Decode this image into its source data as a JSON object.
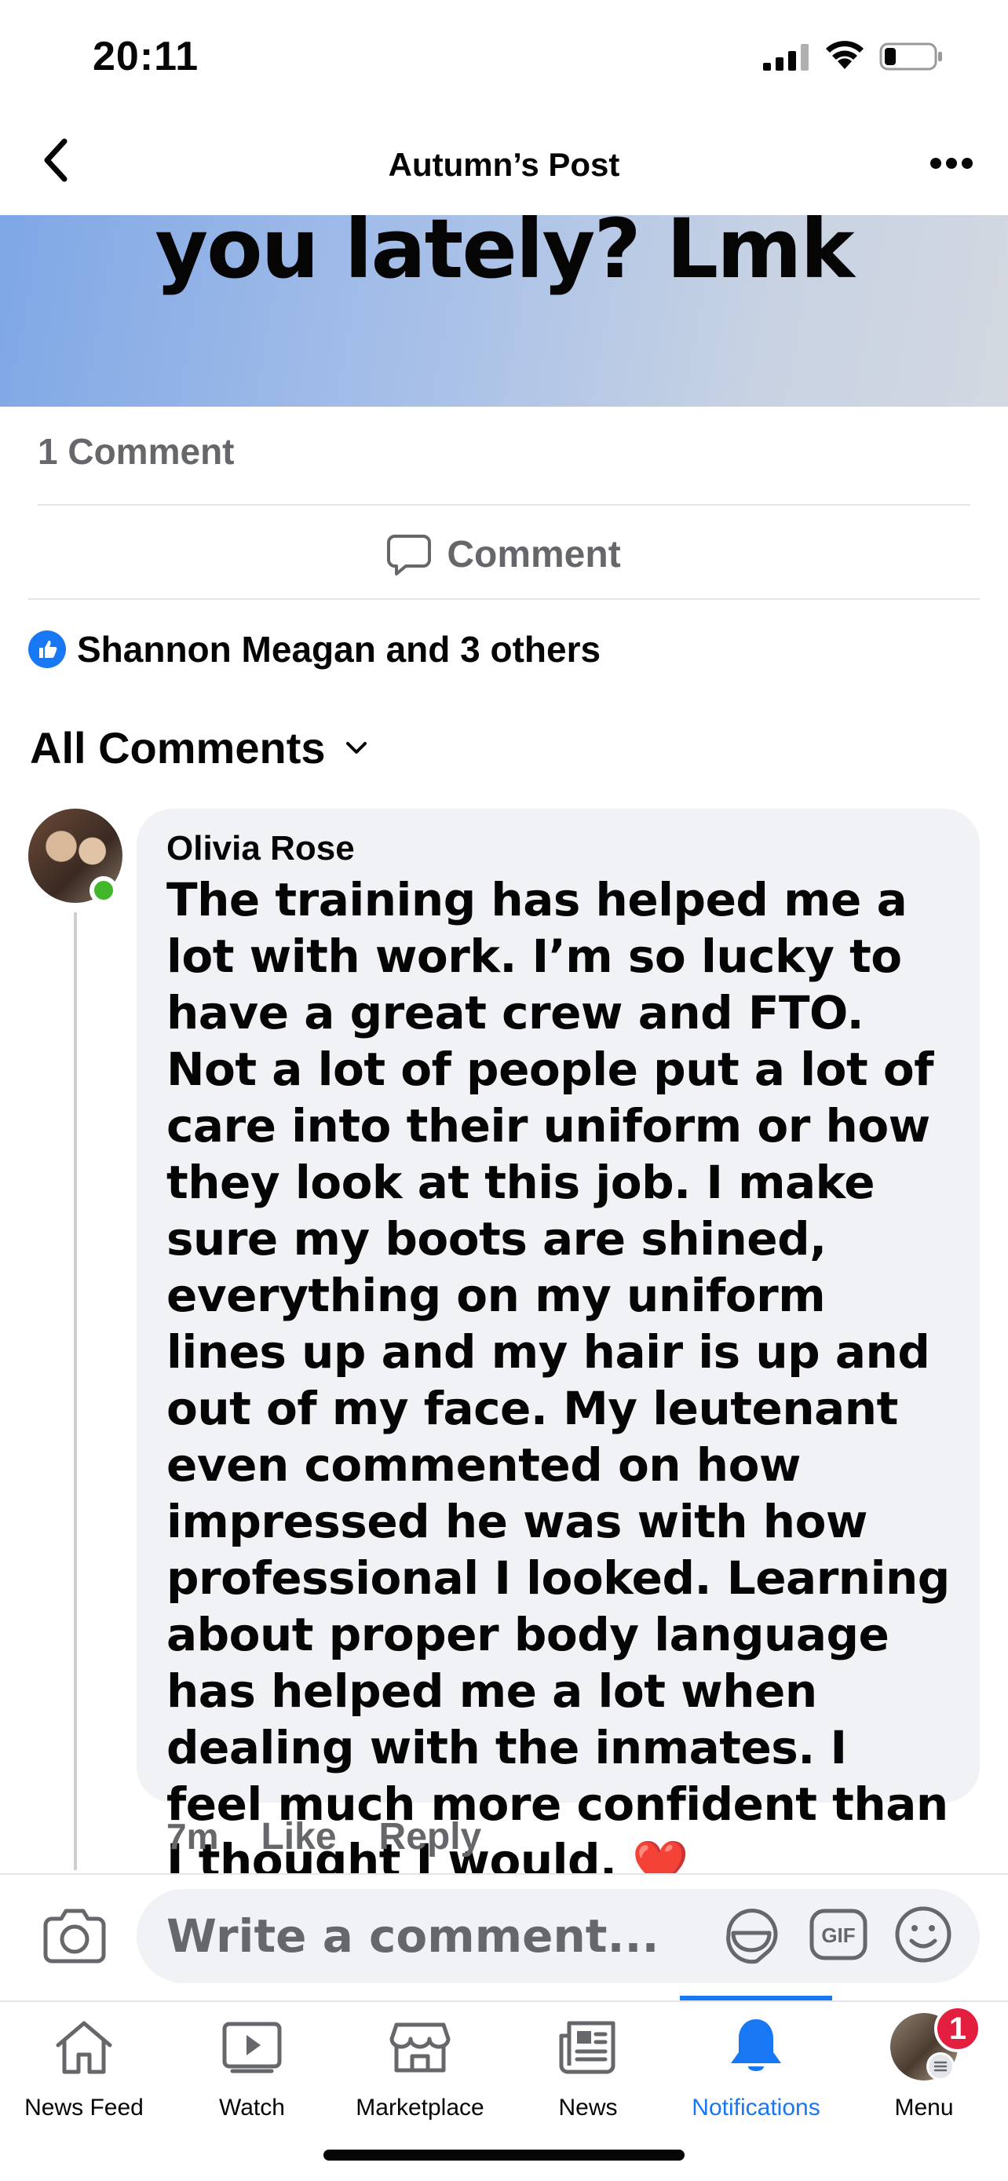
{
  "status_bar": {
    "time": "20:11"
  },
  "header": {
    "title": "Autumn’s Post"
  },
  "post": {
    "banner_text": "you lately? Lmk",
    "comment_count": "1 Comment",
    "comment_action_label": "Comment",
    "reactions_text": "Shannon Meagan and 3 others"
  },
  "comments_section": {
    "filter_label": "All Comments"
  },
  "comment": {
    "author": "Olivia Rose",
    "text": "The training has helped me a lot with work. I’m so lucky to have a great crew and FTO. Not a lot of people put a lot of care into their uniform or how they look at this job. I make sure my boots are shined, everything on my uniform lines up and my hair is up and out of my face. My leutenant even commented on how impressed he was with how professional I looked. Learning about proper body language has helped me a lot when dealing with the inmates. I feel much more confident than I thought I would.",
    "emoji": "❤️",
    "time": "7m",
    "like_label": "Like",
    "reply_label": "Reply"
  },
  "composer": {
    "placeholder": "Write a comment..."
  },
  "tabs": [
    {
      "label": "News Feed",
      "icon": "home-icon"
    },
    {
      "label": "Watch",
      "icon": "watch-icon"
    },
    {
      "label": "Marketplace",
      "icon": "marketplace-icon"
    },
    {
      "label": "News",
      "icon": "news-icon"
    },
    {
      "label": "Notifications",
      "icon": "bell-icon",
      "active": true
    },
    {
      "label": "Menu",
      "icon": "profile-avatar"
    }
  ],
  "notification_badge": "1",
  "colors": {
    "accent": "#1877f2",
    "secondary_text": "#65676b",
    "bubble_bg": "#f0f2f5",
    "badge_red": "#e41e3f",
    "online_green": "#42b72a"
  }
}
